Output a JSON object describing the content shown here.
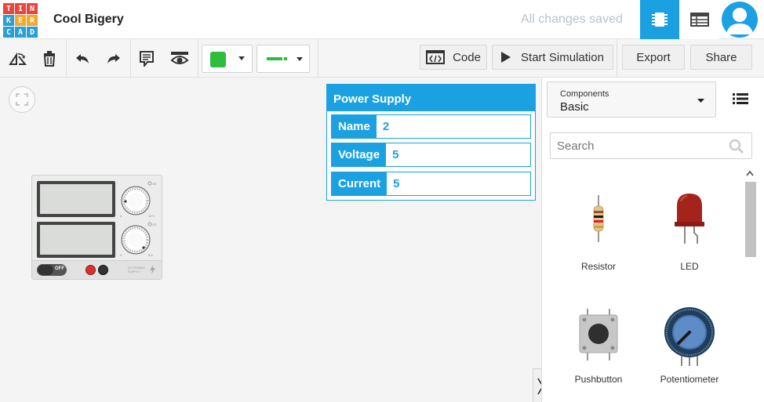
{
  "logo": {
    "letters": [
      "T",
      "I",
      "N",
      "K",
      "E",
      "R",
      "C",
      "A",
      "D"
    ],
    "colors": [
      "#e8453c",
      "#e8453c",
      "#e8453c",
      "#2a9fd6",
      "#f4a72b",
      "#f4a72b",
      "#2a9fd6",
      "#2a9fd6",
      "#2a9fd6"
    ]
  },
  "header": {
    "project_title": "Cool Bigery",
    "saved_status": "All changes saved",
    "accent": "#1ba1e2"
  },
  "toolbar": {
    "code_label": "Code",
    "start_sim_label": "Start Simulation",
    "export_label": "Export",
    "share_label": "Share",
    "wire_color": "#2ebd3c"
  },
  "inspector": {
    "title": "Power Supply",
    "rows": [
      {
        "label": "Name",
        "value": "2"
      },
      {
        "label": "Voltage",
        "value": "5"
      },
      {
        "label": "Current",
        "value": "5"
      }
    ]
  },
  "panel": {
    "components_label": "Components",
    "components_value": "Basic",
    "search_placeholder": "Search",
    "items": [
      {
        "name": "Resistor"
      },
      {
        "name": "LED"
      },
      {
        "name": "Pushbutton"
      },
      {
        "name": "Potentiometer"
      }
    ]
  },
  "device": {
    "switch_label": "OFF",
    "dial1_max": "10 V",
    "dial1_min": "0",
    "dial2_max": "5 A",
    "dial2_min": "0",
    "dial1_tag": "VE",
    "dial2_tag": "CE",
    "label": "DC POWER SUPPLY"
  }
}
